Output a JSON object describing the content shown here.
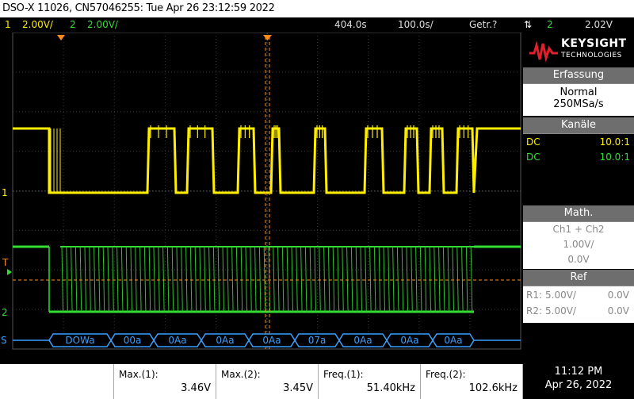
{
  "title": "DSO-X 11026, CN57046255: Tue Apr 26 23:12:59 2022",
  "status": {
    "ch1_num": "1",
    "ch1_scale": "2.00V/",
    "ch2_num": "2",
    "ch2_scale": "2.00V/",
    "time_offset": "404.0s",
    "time_scale": "100.0s/",
    "run_state": "Getr.?",
    "trigger_channel": "2",
    "trigger_level": "2.02V"
  },
  "brand": {
    "name": "KEYSIGHT",
    "sub": "TECHNOLOGIES"
  },
  "acquisition": {
    "header": "Erfassung",
    "mode": "Normal",
    "rate": "250MSa/s"
  },
  "channels": {
    "header": "Kanäle",
    "items": [
      {
        "coupling": "DC",
        "probe": "10.0:1",
        "color": "#ffee00"
      },
      {
        "coupling": "DC",
        "probe": "10.0:1",
        "color": "#33dd33"
      }
    ]
  },
  "math": {
    "header": "Math.",
    "expr": "Ch1 + Ch2",
    "scale": "1.00V/",
    "offset": "0.0V"
  },
  "ref": {
    "header": "Ref",
    "items": [
      {
        "name": "R1:",
        "scale": "5.00V/",
        "offset": "0.0V"
      },
      {
        "name": "R2:",
        "scale": "5.00V/",
        "offset": "0.0V"
      }
    ]
  },
  "decode": {
    "bytes": [
      "DOWa",
      "00a",
      "0Aa",
      "0Aa",
      "0Aa",
      "07a",
      "0Aa",
      "0Aa",
      "0Aa"
    ],
    "marker": "S"
  },
  "markers": {
    "ch1": "1",
    "trig": "T",
    "ch2": "2"
  },
  "measurements": [
    {
      "label": "Max.(1):",
      "value": "3.46V"
    },
    {
      "label": "Max.(2):",
      "value": "3.45V"
    },
    {
      "label": "Freq.(1):",
      "value": "51.40kHz"
    },
    {
      "label": "Freq.(2):",
      "value": "102.6kHz"
    }
  ],
  "clock": {
    "time": "11:12 PM",
    "date": "Apr 26, 2022"
  },
  "colors": {
    "ch1": "#ffee00",
    "ch2": "#33dd33",
    "decode": "#3aa0ff",
    "trigger": "#ff8c1a"
  }
}
